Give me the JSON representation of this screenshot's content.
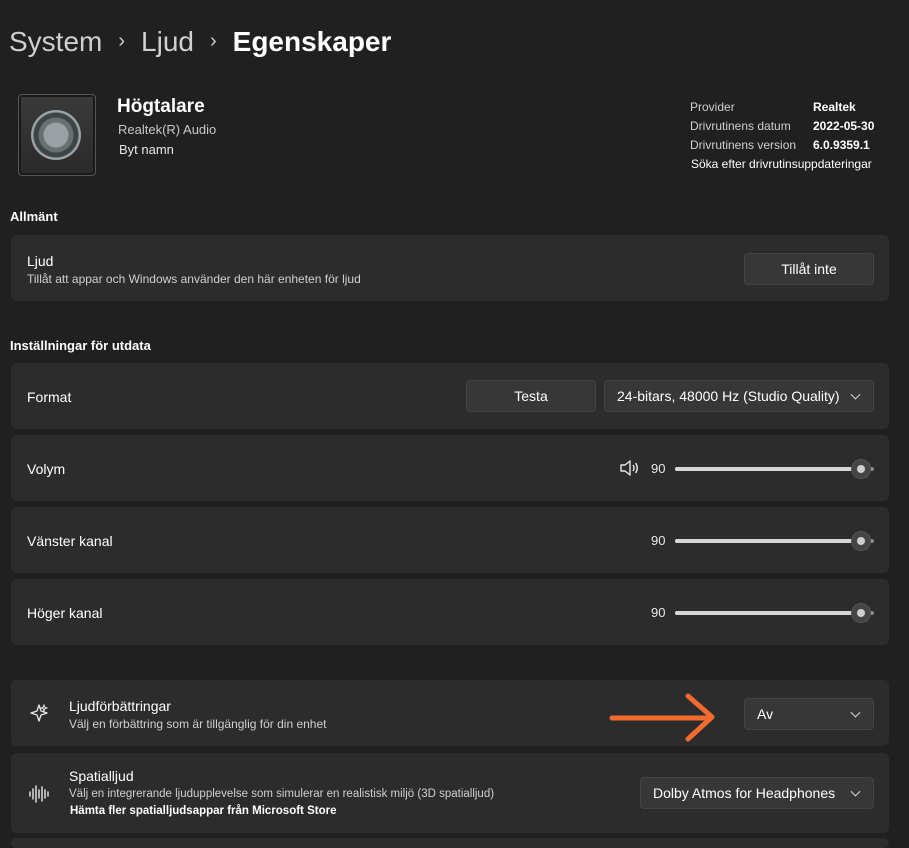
{
  "breadcrumb": {
    "item1": "System",
    "item2": "Ljud",
    "current": "Egenskaper"
  },
  "device": {
    "name": "Högtalare",
    "driver": "Realtek(R) Audio",
    "rename": "Byt namn"
  },
  "info": {
    "provider_label": "Provider",
    "provider_value": "Realtek",
    "date_label": "Drivrutinens datum",
    "date_value": "2022-05-30",
    "version_label": "Drivrutinens version",
    "version_value": "6.0.9359.1",
    "update_link": "Söka efter drivrutinsuppdateringar"
  },
  "general": {
    "title": "Allmänt",
    "audio_title": "Ljud",
    "audio_desc": "Tillåt att appar och Windows använder den här enheten för ljud",
    "disallow_button": "Tillåt inte"
  },
  "output": {
    "title": "Inställningar för utdata",
    "format_label": "Format",
    "test_button": "Testa",
    "format_value": "24-bitars, 48000 Hz (Studio Quality)",
    "volume_label": "Volym",
    "volume_value": "90",
    "left_label": "Vänster kanal",
    "left_value": "90",
    "right_label": "Höger kanal",
    "right_value": "90",
    "level_fraction": 0.9
  },
  "enhancements": {
    "title": "Ljudförbättringar",
    "desc": "Välj en förbättring som är tillgänglig för din enhet",
    "value": "Av"
  },
  "spatial": {
    "title": "Spatialljud",
    "desc": "Välj en integrerande ljudupplevelse som simulerar en realistisk miljö (3D spatialljud)",
    "store_link": "Hämta fler spatialljudsappar från Microsoft Store",
    "value": "Dolby Atmos for Headphones"
  },
  "annotation": {
    "arrow_color": "#f26a2e"
  },
  "colors": {
    "background": "#202020",
    "card": "#2c2c2c",
    "control": "#373737"
  }
}
